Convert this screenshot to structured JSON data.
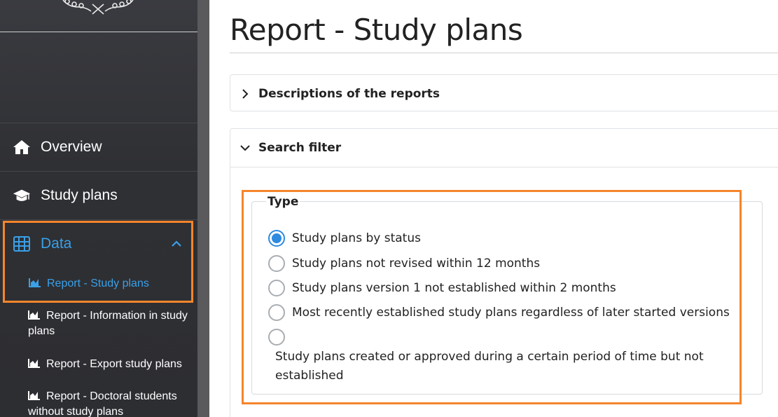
{
  "sidebar": {
    "nav": [
      {
        "label": "Overview",
        "icon": "home-icon"
      },
      {
        "label": "Study plans",
        "icon": "graduation-cap-icon"
      },
      {
        "label": "Data",
        "icon": "table-icon"
      }
    ],
    "sub_items": [
      {
        "label": "Report - Study plans",
        "icon": "chart-area-icon",
        "active": true
      },
      {
        "label": "Report - Information in study plans",
        "icon": "chart-area-icon"
      },
      {
        "label": "Report - Export study plans",
        "icon": "chart-area-icon"
      },
      {
        "label": "Report - Doctoral students without study plans",
        "icon": "chart-area-icon"
      }
    ]
  },
  "main": {
    "title": "Report - Study plans",
    "panels": {
      "descriptions": "Descriptions of the reports",
      "search_filter": "Search filter"
    },
    "type_group": {
      "legend": "Type",
      "options": [
        {
          "label": "Study plans by status",
          "checked": true
        },
        {
          "label": "Study plans not revised within 12 months",
          "checked": false
        },
        {
          "label": "Study plans version 1 not established within 2 months",
          "checked": false
        },
        {
          "label": "Most recently established study plans regardless of later started versions",
          "checked": false
        },
        {
          "label": "Study plans created or approved during a certain period of time but not established",
          "checked": false
        }
      ]
    }
  },
  "colors": {
    "accent": "#3aa0e8",
    "highlight": "#f5852b",
    "radio_checked": "#2d8ae0",
    "sidebar_bg": "#2f3034"
  }
}
